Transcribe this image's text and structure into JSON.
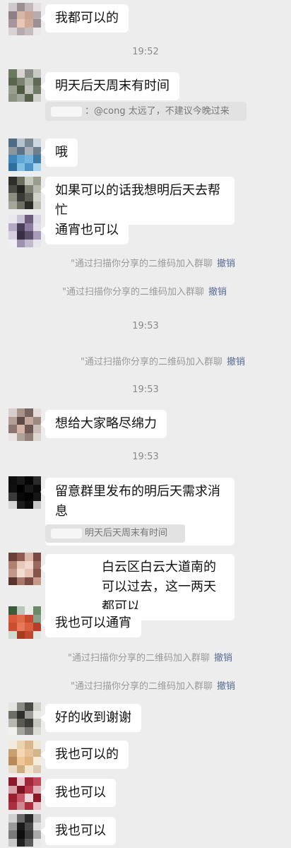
{
  "times": [
    "19:52",
    "19:53",
    "19:53",
    "19:53"
  ],
  "system": {
    "invite_text": "\"通过扫描你分享的二维码加入群聊",
    "undo_label": "撤销"
  },
  "messages": {
    "m1": "我都可以的",
    "m2": "明天后天周末有时间",
    "m2_quote": "：@cong 太远了，不建议今晚过来",
    "m3": "哦",
    "m4": "如果可以的话我想明后天去帮忙",
    "m5": "通宵也可以",
    "m6": "想给大家略尽绵力",
    "m7": "留意群里发布的明后天需求消息",
    "m7_emoji": "🤝",
    "m7_quote": "明天后天周末有时间",
    "m8": "白云区白云大道南的可以过去，这一两天都可以",
    "m9": "我也可以通宵",
    "m10": "好的收到谢谢",
    "m11": "我也可以的",
    "m12": "我也可以",
    "m13": "我也可以"
  },
  "colors": {
    "background": "#ededed",
    "bubble": "#ffffff",
    "link": "#576b95"
  }
}
